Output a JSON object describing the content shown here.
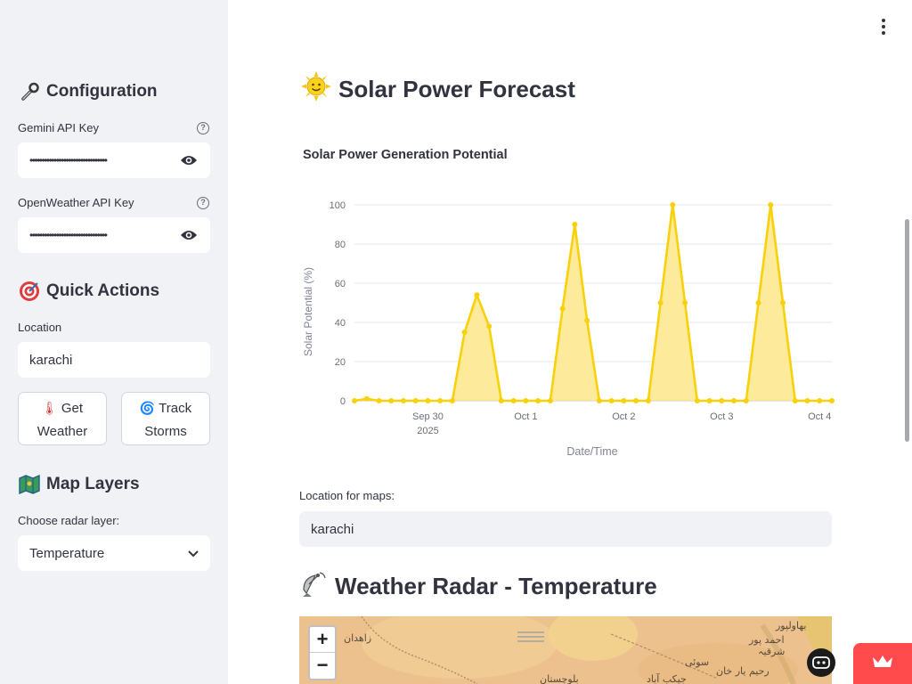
{
  "sidebar": {
    "config_heading": "Configuration",
    "gemini_label": "Gemini API Key",
    "gemini_value": "••••••••••••••••••••••••••••••••",
    "openweather_label": "OpenWeather API Key",
    "openweather_value": "••••••••••••••••••••••••••••••••",
    "quick_actions_heading": "Quick Actions",
    "location_label": "Location",
    "location_value": "karachi",
    "get_weather_icon": "🌡",
    "get_weather_line1": "Get",
    "get_weather_line2": "Weather",
    "track_storms_icon": "🌀",
    "track_storms_line1": "Track",
    "track_storms_line2": "Storms",
    "map_layers_heading": "Map Layers",
    "radar_layer_label": "Choose radar layer:",
    "radar_layer_value": "Temperature"
  },
  "main": {
    "title": "Solar Power Forecast",
    "chart_title": "Solar Power Generation Potential",
    "maps_location_label": "Location for maps:",
    "maps_location_value": "karachi",
    "radar_title": "Weather Radar - Temperature",
    "zoom_in": "+",
    "zoom_out": "−",
    "map_labels": [
      "زاهدان",
      "بهاولپور",
      "احمد پور",
      "شرقیہ",
      "سوئی",
      "رحیم یار خان",
      "بلوچستان",
      "جيکب آباد"
    ]
  },
  "colors": {
    "accent": "#ff4b4b",
    "series_line": "#f8d10a",
    "series_fill": "#fde88a",
    "sidebar_bg": "#f0f2f6"
  },
  "chart_data": {
    "type": "area",
    "title": "Solar Power Generation Potential",
    "xlabel": "Date/Time",
    "ylabel": "Solar Potential (%)",
    "ylim": [
      0,
      100
    ],
    "yticks": [
      0,
      20,
      40,
      60,
      80,
      100
    ],
    "xticks": [
      {
        "t": "2025-09-30 00:00",
        "label": "Sep 30",
        "sub": "2025"
      },
      {
        "t": "2025-10-01 00:00",
        "label": "Oct 1",
        "sub": ""
      },
      {
        "t": "2025-10-02 00:00",
        "label": "Oct 2",
        "sub": ""
      },
      {
        "t": "2025-10-03 00:00",
        "label": "Oct 3",
        "sub": ""
      },
      {
        "t": "2025-10-04 00:00",
        "label": "Oct 4",
        "sub": ""
      }
    ],
    "grid": true,
    "series": [
      {
        "points": [
          [
            "2025-09-29 06:00",
            0
          ],
          [
            "2025-09-29 09:00",
            1
          ],
          [
            "2025-09-29 12:00",
            0
          ],
          [
            "2025-09-29 15:00",
            0
          ],
          [
            "2025-09-29 18:00",
            0
          ],
          [
            "2025-09-29 21:00",
            0
          ],
          [
            "2025-09-30 00:00",
            0
          ],
          [
            "2025-09-30 03:00",
            0
          ],
          [
            "2025-09-30 06:00",
            0
          ],
          [
            "2025-09-30 09:00",
            35
          ],
          [
            "2025-09-30 12:00",
            54
          ],
          [
            "2025-09-30 15:00",
            38
          ],
          [
            "2025-09-30 18:00",
            0
          ],
          [
            "2025-09-30 21:00",
            0
          ],
          [
            "2025-10-01 00:00",
            0
          ],
          [
            "2025-10-01 03:00",
            0
          ],
          [
            "2025-10-01 06:00",
            0
          ],
          [
            "2025-10-01 09:00",
            47
          ],
          [
            "2025-10-01 12:00",
            90
          ],
          [
            "2025-10-01 15:00",
            41
          ],
          [
            "2025-10-01 18:00",
            0
          ],
          [
            "2025-10-01 21:00",
            0
          ],
          [
            "2025-10-02 00:00",
            0
          ],
          [
            "2025-10-02 03:00",
            0
          ],
          [
            "2025-10-02 06:00",
            0
          ],
          [
            "2025-10-02 09:00",
            50
          ],
          [
            "2025-10-02 12:00",
            100
          ],
          [
            "2025-10-02 15:00",
            50
          ],
          [
            "2025-10-02 18:00",
            0
          ],
          [
            "2025-10-02 21:00",
            0
          ],
          [
            "2025-10-03 00:00",
            0
          ],
          [
            "2025-10-03 03:00",
            0
          ],
          [
            "2025-10-03 06:00",
            0
          ],
          [
            "2025-10-03 09:00",
            50
          ],
          [
            "2025-10-03 12:00",
            100
          ],
          [
            "2025-10-03 15:00",
            50
          ],
          [
            "2025-10-03 18:00",
            0
          ],
          [
            "2025-10-03 21:00",
            0
          ],
          [
            "2025-10-04 00:00",
            0
          ],
          [
            "2025-10-04 03:00",
            0
          ]
        ]
      }
    ]
  }
}
